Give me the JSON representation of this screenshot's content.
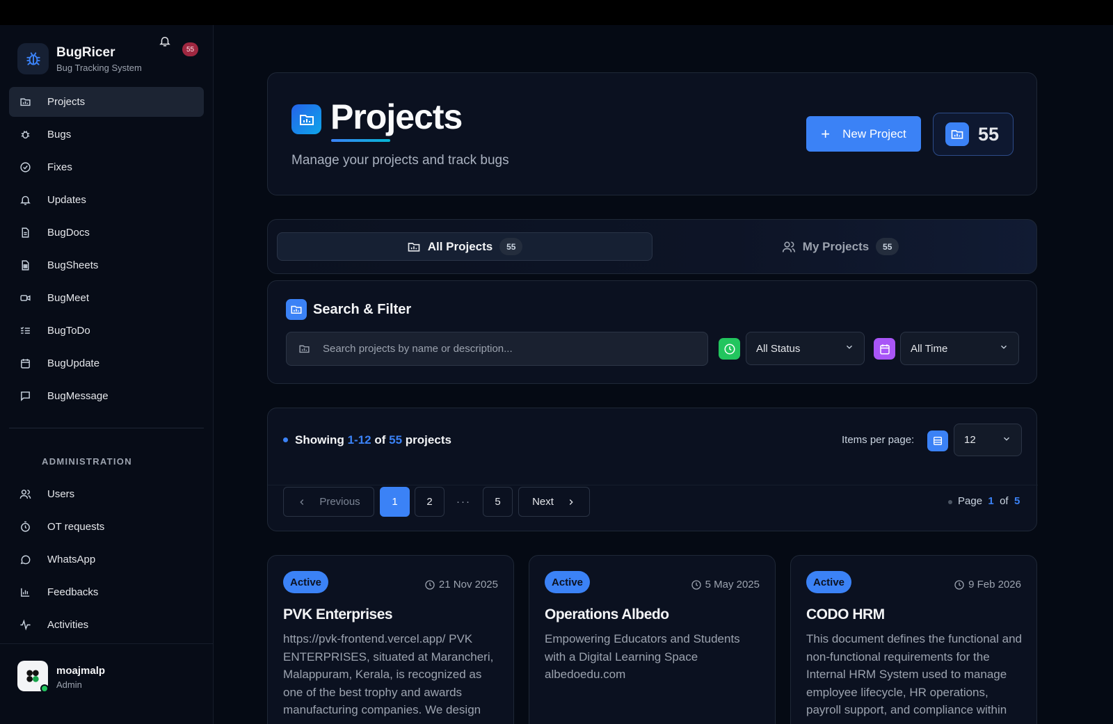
{
  "brand": {
    "name": "BugRicer",
    "subtitle": "Bug Tracking System",
    "notification_count": "55"
  },
  "sidebar": {
    "items": [
      {
        "label": "Projects",
        "icon": "folder-chart-icon",
        "active": true
      },
      {
        "label": "Bugs",
        "icon": "bug-icon"
      },
      {
        "label": "Fixes",
        "icon": "check-circle-icon"
      },
      {
        "label": "Updates",
        "icon": "bell-icon"
      },
      {
        "label": "BugDocs",
        "icon": "document-icon"
      },
      {
        "label": "BugSheets",
        "icon": "sheet-icon"
      },
      {
        "label": "BugMeet",
        "icon": "video-icon"
      },
      {
        "label": "BugToDo",
        "icon": "list-check-icon"
      },
      {
        "label": "BugUpdate",
        "icon": "calendar-icon"
      },
      {
        "label": "BugMessage",
        "icon": "message-icon"
      }
    ],
    "admin_label": "ADMINISTRATION",
    "admin_items": [
      {
        "label": "Users",
        "icon": "users-icon"
      },
      {
        "label": "OT requests",
        "icon": "timer-icon"
      },
      {
        "label": "WhatsApp",
        "icon": "chat-bubble-icon"
      },
      {
        "label": "Feedbacks",
        "icon": "bar-chart-icon"
      },
      {
        "label": "Activities",
        "icon": "activity-icon"
      }
    ]
  },
  "user": {
    "name": "moajmalp",
    "role": "Admin"
  },
  "header": {
    "title": "Projects",
    "subtitle": "Manage your projects and track bugs",
    "new_button": "New Project",
    "count": "55"
  },
  "tabs": [
    {
      "label": "All Projects",
      "count": "55",
      "active": true
    },
    {
      "label": "My Projects",
      "count": "55",
      "active": false
    }
  ],
  "filter": {
    "title": "Search & Filter",
    "search_placeholder": "Search projects by name or description...",
    "status_value": "All Status",
    "time_value": "All Time"
  },
  "pagination": {
    "showing_prefix": "Showing",
    "range_start": "1",
    "range_sep": "-",
    "range_end": "12",
    "of_word": "of",
    "total": "55",
    "suffix": "projects",
    "items_per_page_label": "Items per page:",
    "items_per_page": "12",
    "prev_label": "Previous",
    "next_label": "Next",
    "pages": [
      "1",
      "2",
      "5"
    ],
    "ellipsis": "···",
    "page_label": "Page",
    "current_page": "1",
    "page_of": "of",
    "total_pages": "5"
  },
  "projects": [
    {
      "status": "Active",
      "date": "21 Nov 2025",
      "title": "PVK Enterprises",
      "description": "https://pvk-frontend.vercel.app/ PVK ENTERPRISES, situated at Marancheri, Malappuram, Kerala, is recognized as one of the best trophy and awards manufacturing companies. We design"
    },
    {
      "status": "Active",
      "date": "5 May 2025",
      "title": "Operations Albedo",
      "description": "Empowering Educators and Students with a Digital Learning Space albedoedu.com"
    },
    {
      "status": "Active",
      "date": "9 Feb 2026",
      "title": "CODO HRM",
      "description": "This document defines the functional and non-functional requirements for the Internal HRM System used to manage employee lifecycle, HR operations, payroll support, and compliance within"
    }
  ],
  "colors": {
    "accent": "#3b82f6",
    "success": "#22c55e",
    "purple": "#a855f7",
    "badge": "#9f2740"
  }
}
